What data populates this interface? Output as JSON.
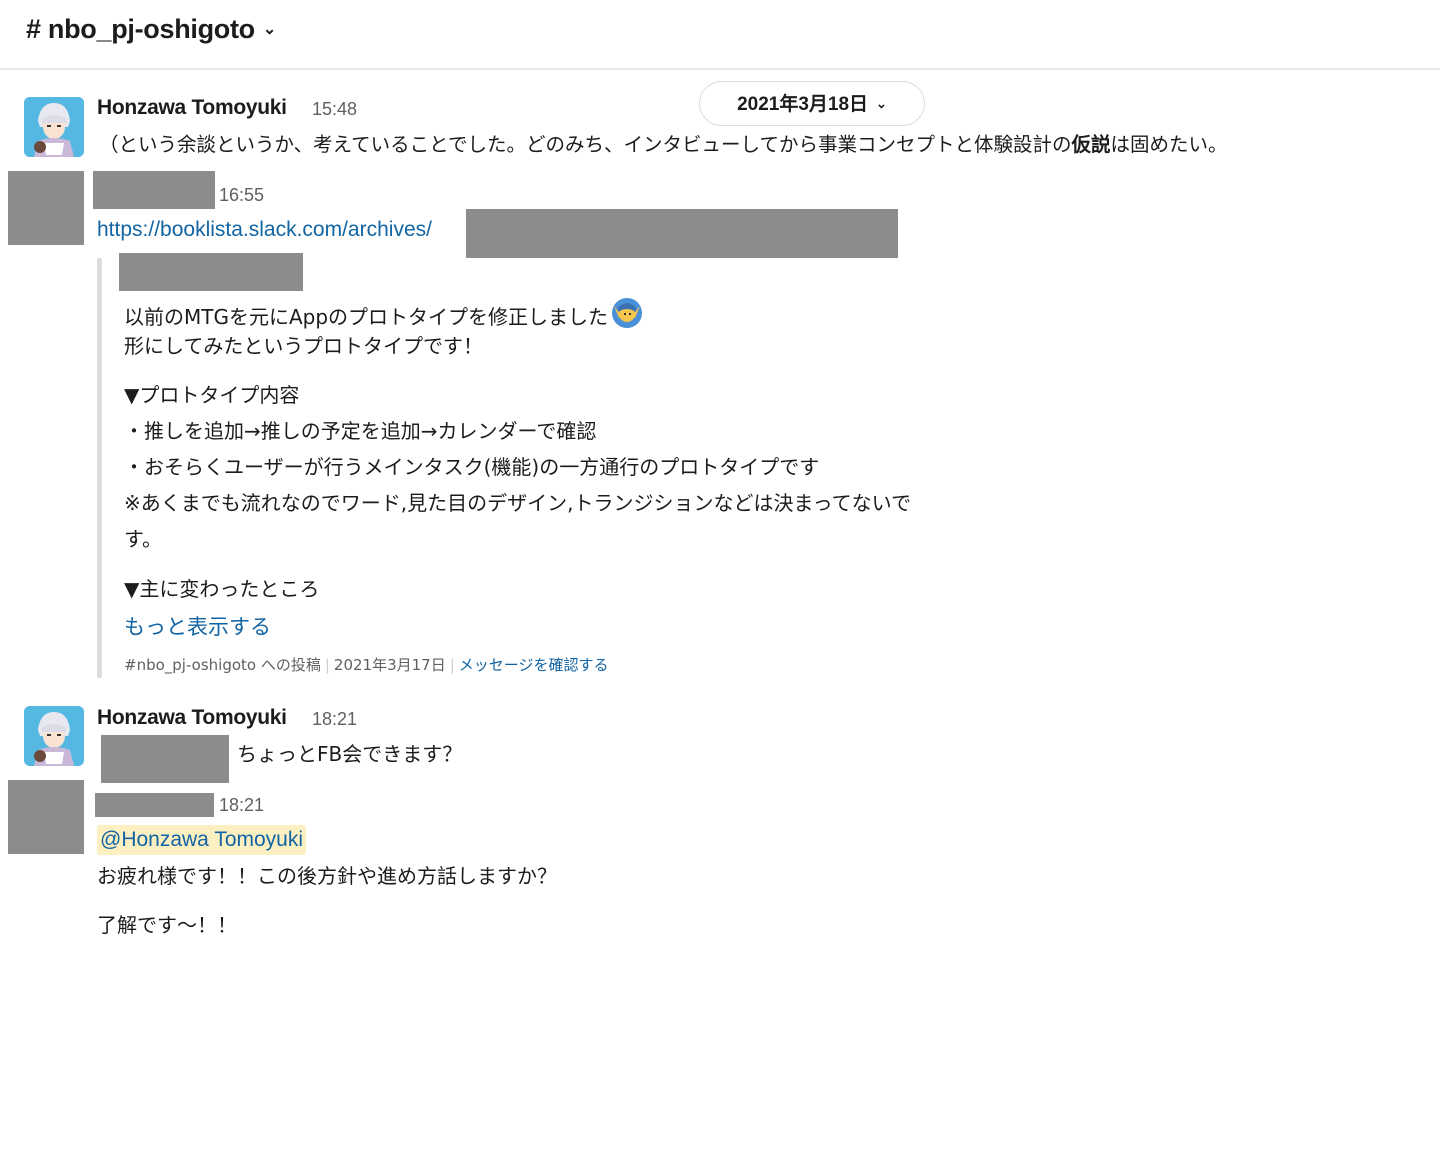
{
  "header": {
    "channel_name": "# nbo_pj-oshigoto",
    "dropdown_icon": "chevron-down-icon"
  },
  "date_divider": {
    "label": "2021年3月18日",
    "dropdown_icon": "chevron-down-icon"
  },
  "messages": [
    {
      "author": "Honzawa Tomoyuki",
      "time": "15:48",
      "text_before": "（という余談というか、考えていることでした。どのみち、インタビューしてから事業コンセプトと体験設計の",
      "text_bold": "仮説",
      "text_after": "は固めたい。"
    },
    {
      "author": "",
      "time": "16:55",
      "link_text": "https://booklista.slack.com/archives/",
      "shared": {
        "line1": "以前のMTGを元にAppのプロトタイプを修正しました",
        "line1_emoji": "person-raising-hand-emoji",
        "line2": "形にしてみたというプロトタイプです！",
        "line3": "▼プロトタイプ内容",
        "line4": "・推しを追加→推しの予定を追加→カレンダーで確認",
        "line5": "・おそらくユーザーが行うメインタスク(機能)の一方通行のプロトタイプです",
        "line6": "※あくまでも流れなのでワード,見た目のデザイン,トランジションなどは決まってないで",
        "line7": "す。",
        "line8": "▼主に変わったところ",
        "show_more": "もっと表示する",
        "footer_channel": "#nbo_pj-oshigoto への投稿",
        "footer_date": "2021年3月17日",
        "footer_confirm": "メッセージを確認する"
      }
    },
    {
      "author": "Honzawa Tomoyuki",
      "time": "18:21",
      "text": "ちょっとFB会できます？"
    },
    {
      "author": "",
      "time": "18:21",
      "mention": "@Honzawa Tomoyuki",
      "line1": "お疲れ様です！！この後方針や進め方話しますか？",
      "line2": "了解です〜！！"
    }
  ]
}
